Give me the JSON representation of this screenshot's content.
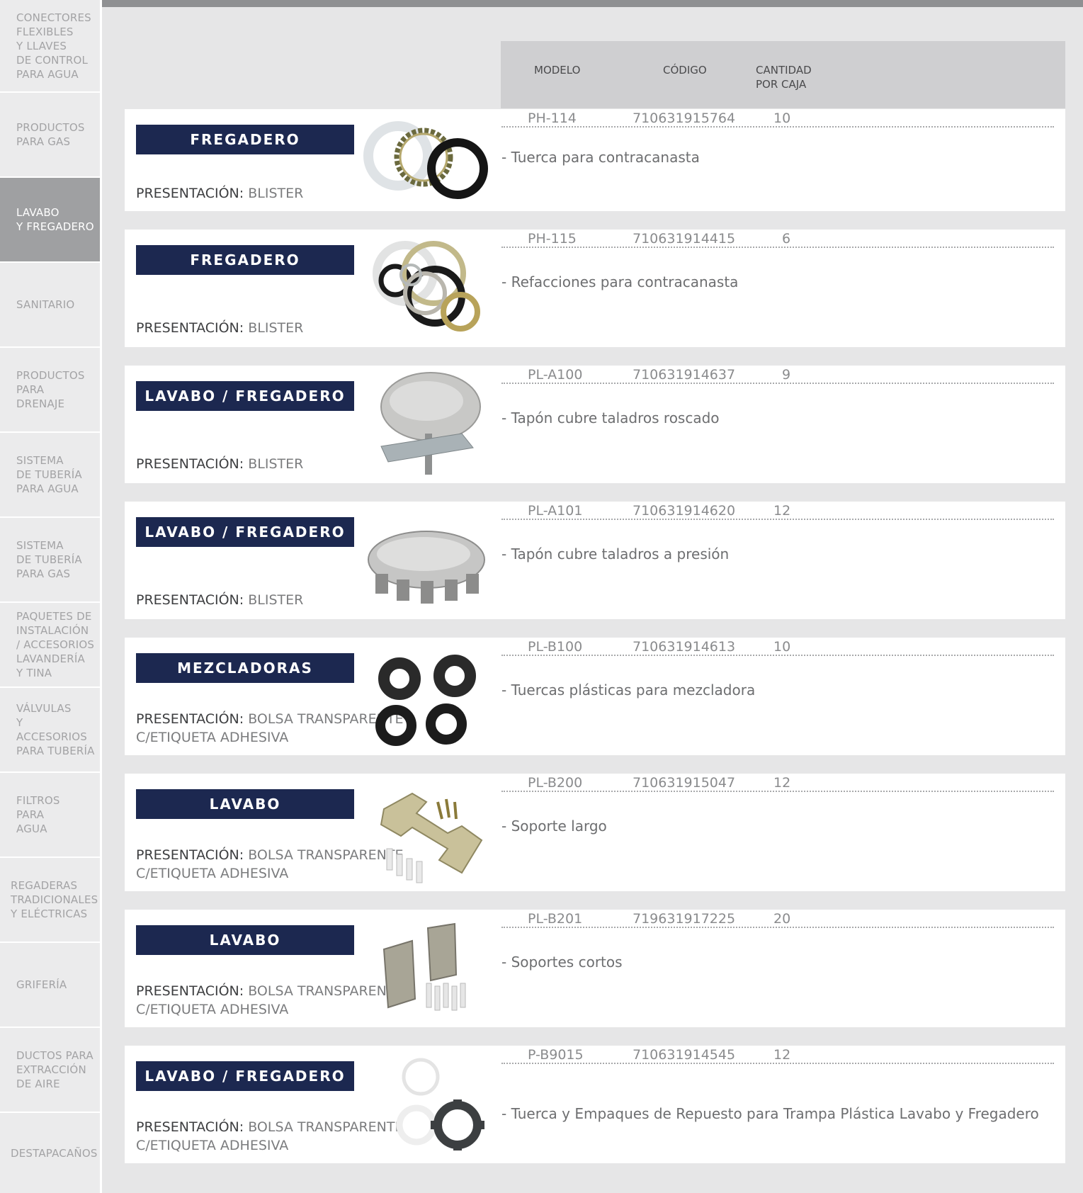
{
  "sidebar": {
    "items": [
      {
        "label": "CONECTORES\nFLEXIBLES\nY LLAVES\nDE CONTROL\nPARA AGUA"
      },
      {
        "label": "PRODUCTOS\nPARA GAS"
      },
      {
        "label": "LAVABO\nY FREGADERO"
      },
      {
        "label": "SANITARIO"
      },
      {
        "label": "PRODUCTOS\nPARA\nDRENAJE"
      },
      {
        "label": "SISTEMA\nDE TUBERÍA\nPARA AGUA"
      },
      {
        "label": "SISTEMA\nDE TUBERÍA\nPARA GAS"
      },
      {
        "label": "PAQUETES DE\nINSTALACIÓN\n/ ACCESORIOS\nLAVANDERÍA\nY TINA"
      },
      {
        "label": "VÁLVULAS\nY ACCESORIOS\nPARA TUBERÍA"
      },
      {
        "label": "FILTROS\nPARA\nAGUA"
      },
      {
        "label": "REGADERAS\nTRADICIONALES\nY ELÉCTRICAS"
      },
      {
        "label": "GRIFERÍA"
      },
      {
        "label": "DUCTOS PARA\nEXTRACCIÓN\nDE AIRE"
      },
      {
        "label": "DESTAPACAÑOS"
      }
    ]
  },
  "header": {
    "modelo": "MODELO",
    "codigo": "CÓDIGO",
    "cantidad": "CANTIDAD\nPOR CAJA"
  },
  "presentation_label": "PRESENTACIÓN:",
  "products": [
    {
      "category": "FREGADERO",
      "presentation": " BLISTER",
      "model": "PH-114",
      "code": "710631915764",
      "qty": "10",
      "description": "- Tuerca para contracanasta",
      "image": "gasket-rings-icon"
    },
    {
      "category": "FREGADERO",
      "presentation": " BLISTER",
      "model": "PH-115",
      "code": "710631914415",
      "qty": "6",
      "description": "- Refacciones para contracanasta",
      "image": "gasket-set-icon"
    },
    {
      "category": "LAVABO / FREGADERO",
      "presentation": " BLISTER",
      "model": "PL-A100",
      "code": "710631914637",
      "qty": "9",
      "description": "- Tapón cubre taladros roscado",
      "image": "threaded-cap-icon"
    },
    {
      "category": "LAVABO / FREGADERO",
      "presentation": " BLISTER",
      "model": "PL-A101",
      "code": "710631914620",
      "qty": "12",
      "description": "- Tapón cubre taladros a presión",
      "image": "press-cap-icon"
    },
    {
      "category": "MEZCLADORAS",
      "presentation": " BOLSA TRANSPARENTE\nC/ETIQUETA ADHESIVA",
      "model": "PL-B100",
      "code": "710631914613",
      "qty": "10",
      "description": "- Tuercas plásticas para mezcladora",
      "image": "plastic-nuts-icon"
    },
    {
      "category": "LAVABO",
      "presentation": " BOLSA TRANSPARENTE\nC/ETIQUETA ADHESIVA",
      "model": "PL-B200",
      "code": "710631915047",
      "qty": "12",
      "description": "- Soporte largo",
      "image": "long-bracket-icon"
    },
    {
      "category": "LAVABO",
      "presentation": " BOLSA TRANSPARENTE\nC/ETIQUETA ADHESIVA",
      "model": "PL-B201",
      "code": "719631917225",
      "qty": "20",
      "description": "- Soportes cortos",
      "image": "short-brackets-icon"
    },
    {
      "category": "LAVABO / FREGADERO",
      "presentation": " BOLSA TRANSPARENTE\nC/ETIQUETA ADHESIVA",
      "model": "P-B9015",
      "code": "710631914545",
      "qty": "12",
      "description": "- Tuerca y Empaques de Repuesto para Trampa Plástica Lavabo y Fregadero",
      "image": "trap-nut-gaskets-icon"
    }
  ]
}
